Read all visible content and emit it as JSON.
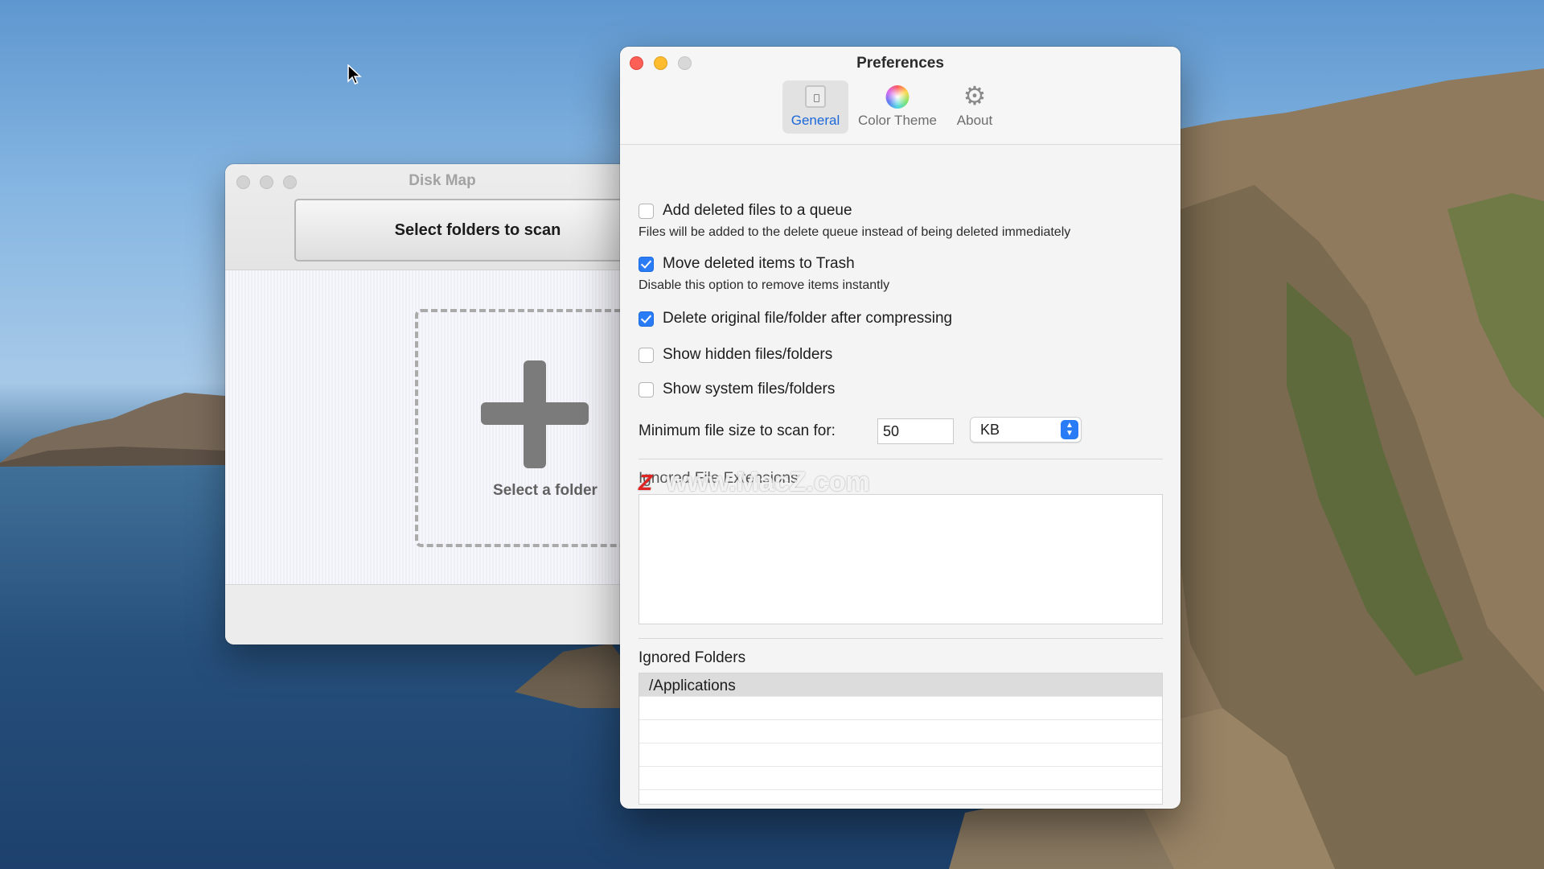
{
  "disk_map": {
    "title": "Disk Map",
    "scan_button": "Select folders to scan",
    "drop_label": "Select a folder"
  },
  "preferences": {
    "title": "Preferences",
    "tabs": [
      {
        "label": "General",
        "icon": "general-icon",
        "selected": true
      },
      {
        "label": "Color Theme",
        "icon": "color-wheel-icon",
        "selected": false
      },
      {
        "label": "About",
        "icon": "gear-icon",
        "selected": false
      }
    ],
    "options": [
      {
        "label": "Add deleted files to a queue",
        "checked": false,
        "hint": "Files will be added to the delete queue instead of being deleted immediately"
      },
      {
        "label": "Move deleted items to Trash",
        "checked": true,
        "hint": "Disable this option to remove items instantly"
      },
      {
        "label": "Delete original file/folder after compressing",
        "checked": true
      },
      {
        "label": "Show hidden files/folders",
        "checked": false
      },
      {
        "label": "Show system files/folders",
        "checked": false
      }
    ],
    "min_size": {
      "label": "Minimum file size to scan for:",
      "value": "50",
      "unit": "KB"
    },
    "ignored_extensions_label": "Ignored File Extensions",
    "ignored_folders": {
      "label": "Ignored Folders",
      "items": [
        "/Applications"
      ]
    },
    "add_button": "+",
    "remove_button": "−"
  },
  "watermark": "www.MacZ.com",
  "colors": {
    "accent": "#2a7cf6",
    "close": "#fe5f57",
    "minimize": "#febc2e"
  }
}
